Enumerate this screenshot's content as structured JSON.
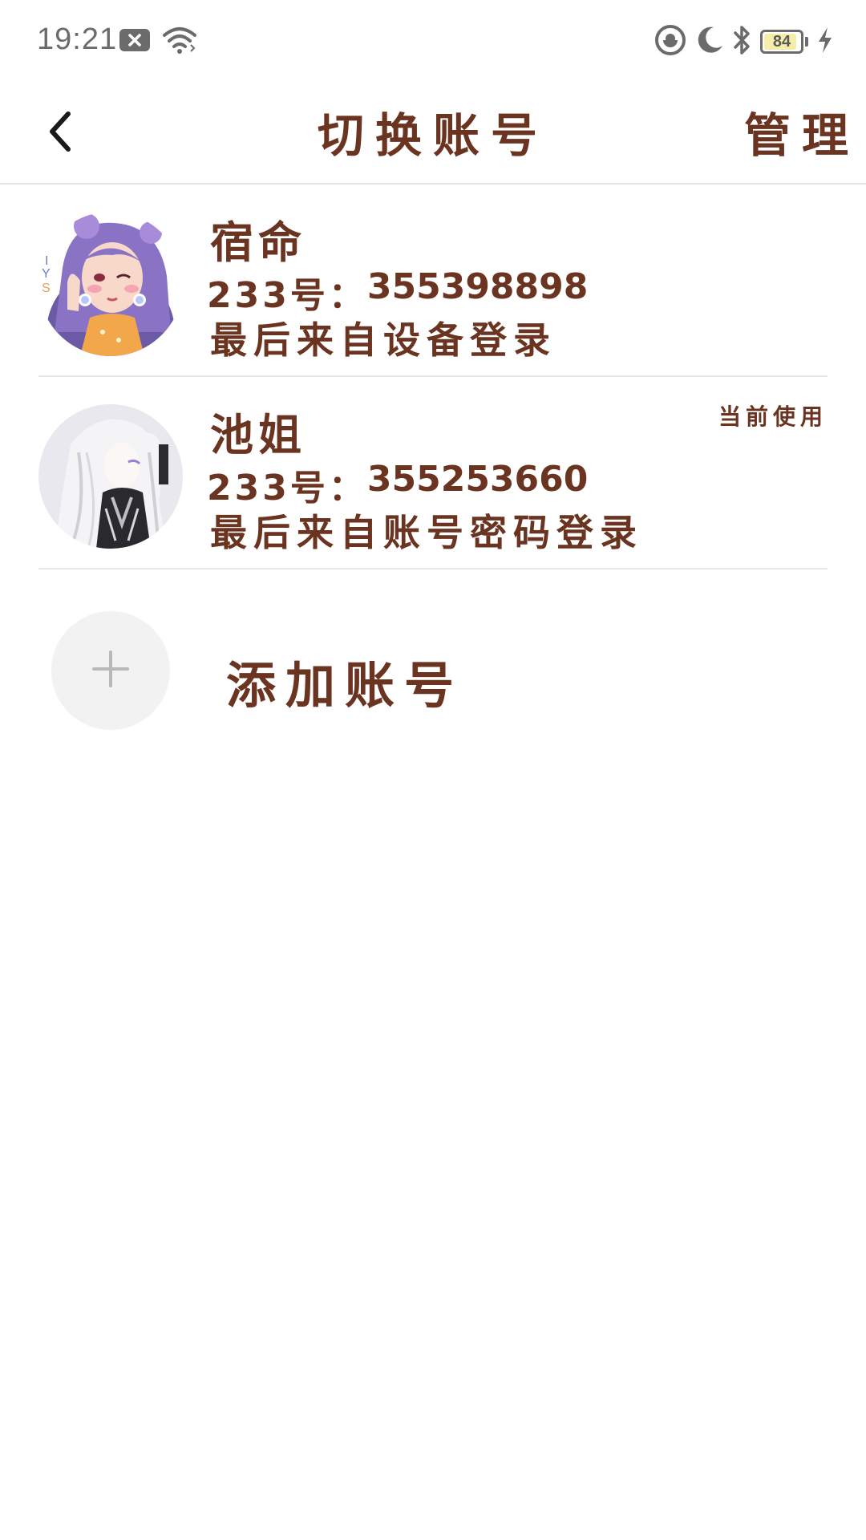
{
  "status_bar": {
    "time": "19:21",
    "battery_level": "84",
    "icons": [
      "notification-dismiss-icon",
      "wifi-icon",
      "focus-mode-icon",
      "moon-icon",
      "bluetooth-icon",
      "battery-icon",
      "charging-bolt-icon"
    ]
  },
  "header": {
    "title": "切换账号",
    "manage_label": "管理",
    "back_icon": "chevron-left-icon"
  },
  "accounts": [
    {
      "name": "宿命",
      "id_label": "233号：",
      "id_value": "355398898",
      "login_source": "最后来自设备登录",
      "current": ""
    },
    {
      "name": "池姐",
      "id_label": "233号：",
      "id_value": "355253660",
      "login_source": "最后来自账号密码登录",
      "current": "当前使用"
    }
  ],
  "add_account": {
    "label": "添加账号",
    "icon": "plus-icon"
  },
  "colors": {
    "text_brown": "#6a3421",
    "divider": "#e6e6e6",
    "add_circle_bg": "#f2f2f2",
    "status_gray": "#6b6b6b"
  }
}
